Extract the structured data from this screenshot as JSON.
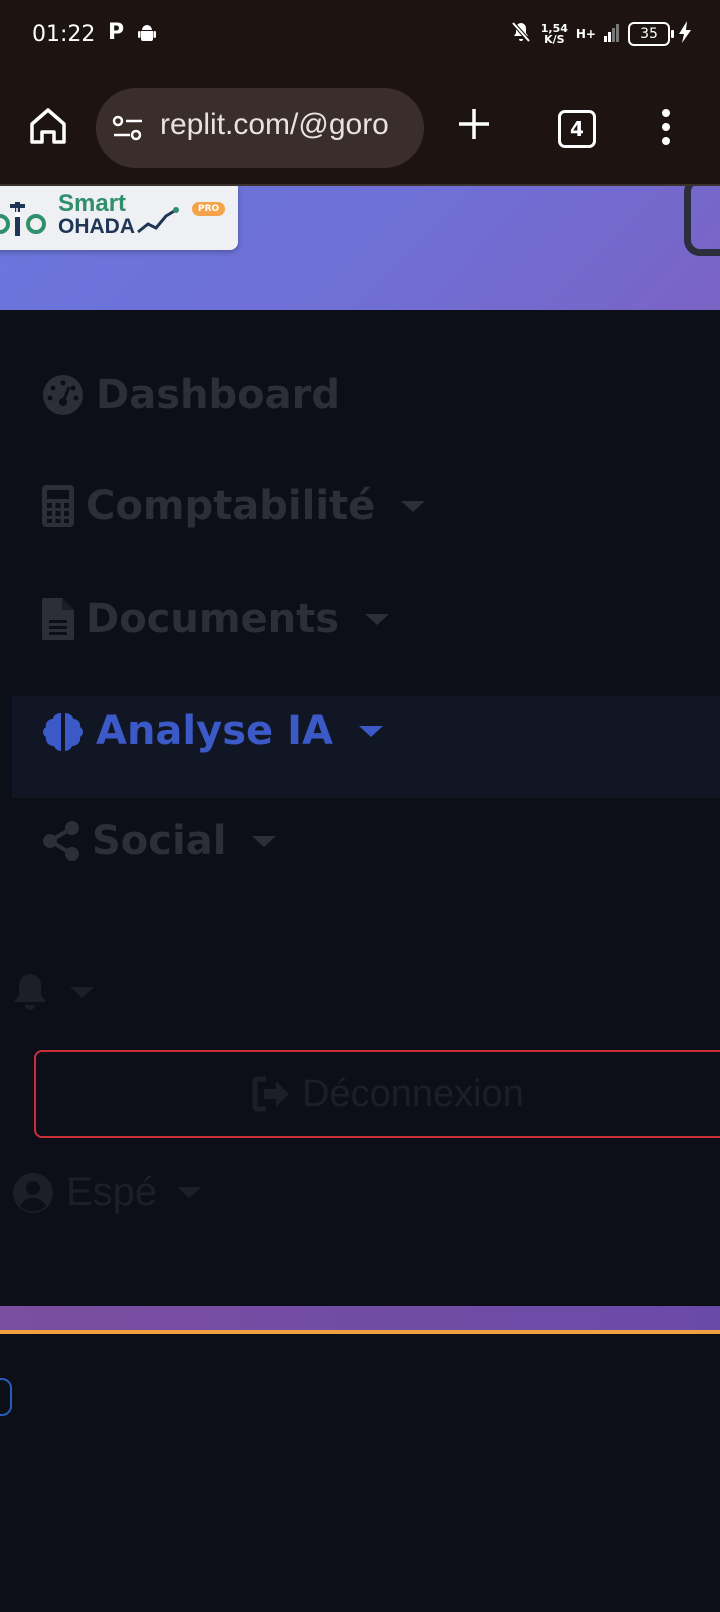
{
  "status_bar": {
    "time": "01:22",
    "p_label": "P",
    "net_speed_value": "1,54",
    "net_speed_unit": "K/S",
    "network_type": "H+",
    "battery_level": "35"
  },
  "browser": {
    "url": "replit.com/@goro",
    "tab_count": "4"
  },
  "app": {
    "logo": {
      "line1": "Smart",
      "line2": "OHADA",
      "badge": "PRO"
    },
    "nav": {
      "items": [
        {
          "label": "Dashboard",
          "icon": "dashboard-gauge-icon"
        },
        {
          "label": "Comptabilité",
          "icon": "calculator-icon"
        },
        {
          "label": "Documents",
          "icon": "document-icon"
        },
        {
          "label": "Analyse IA",
          "icon": "brain-icon",
          "active": true
        },
        {
          "label": "Social",
          "icon": "share-icon"
        }
      ]
    },
    "logout_label": "Déconnexion",
    "user_label": "Espé"
  },
  "colors": {
    "active_nav": "#3b59c7",
    "logout_border": "#c9303b",
    "header_gradient_start": "#6a76dc",
    "accent_orange": "#f0a040"
  }
}
